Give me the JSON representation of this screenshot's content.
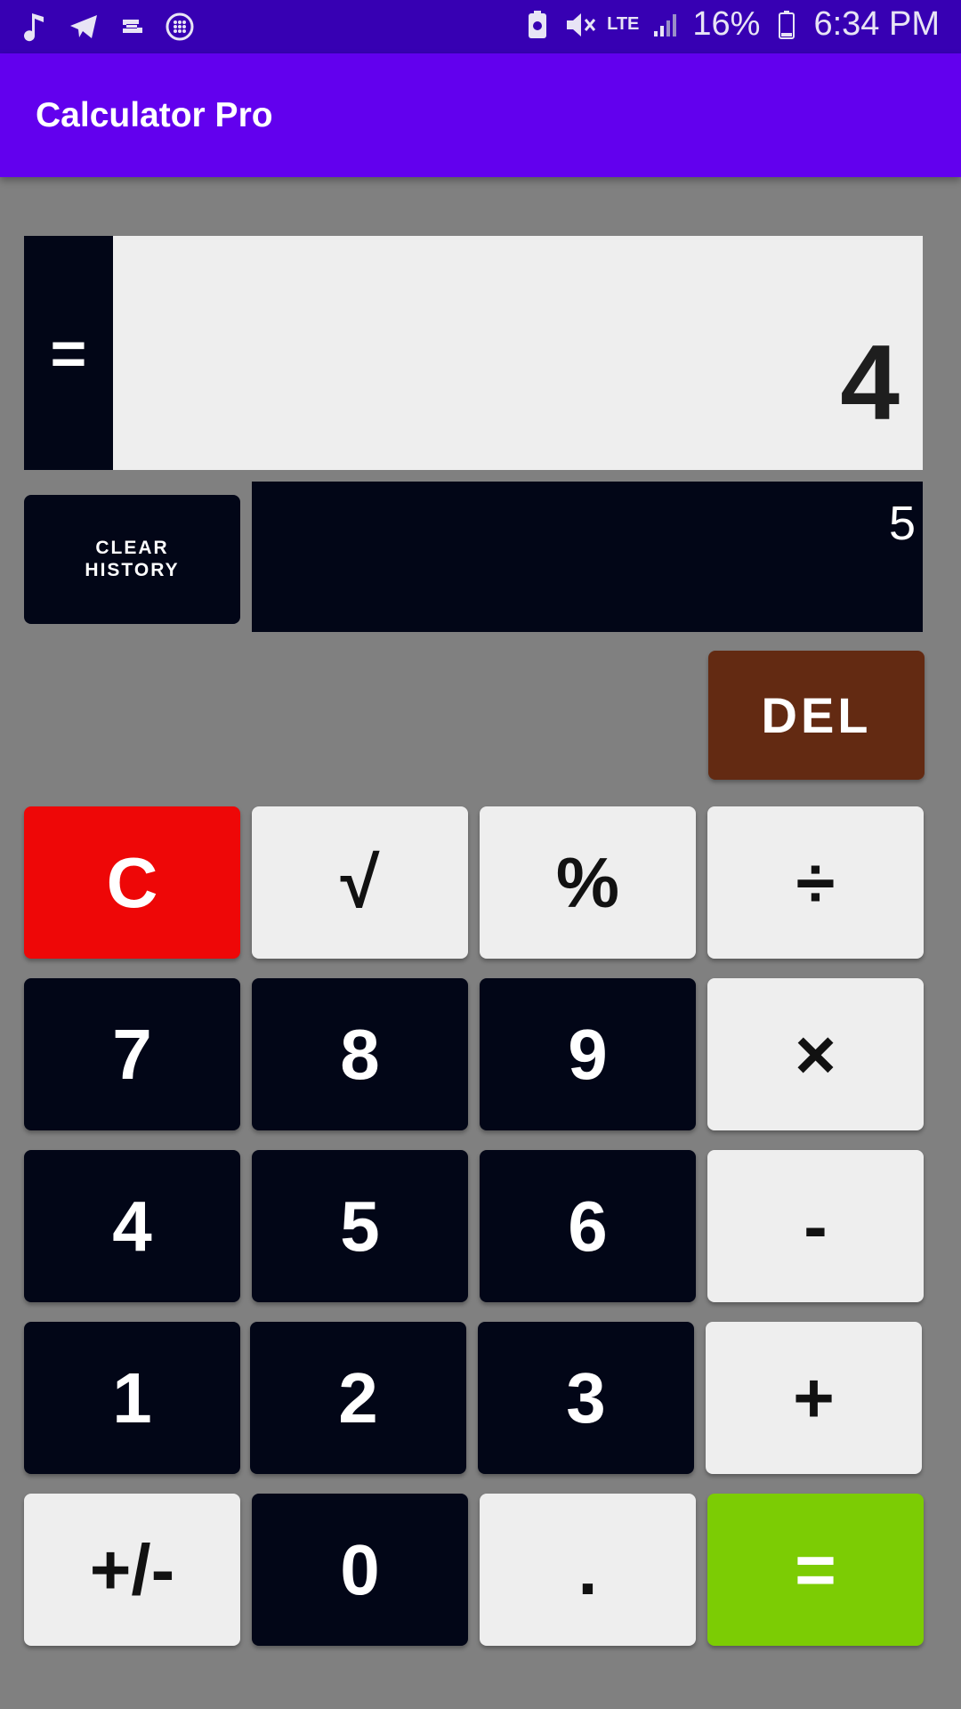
{
  "status_bar": {
    "left_icons": [
      "music-note-icon",
      "telegram-icon",
      "cast-icon",
      "circle-dots-icon"
    ],
    "network": "LTE",
    "battery": "16%",
    "time": "6:34 PM"
  },
  "app_bar": {
    "title": "Calculator Pro"
  },
  "display": {
    "equals_label": "=",
    "result": "4",
    "history_value": "5"
  },
  "buttons": {
    "clear_history": "CLEAR\nHISTORY",
    "del": "DEL",
    "keys": [
      {
        "label": "C",
        "style": "red"
      },
      {
        "label": "√",
        "style": "light"
      },
      {
        "label": "%",
        "style": "light"
      },
      {
        "label": "÷",
        "style": "light"
      },
      {
        "label": "7",
        "style": "dark"
      },
      {
        "label": "8",
        "style": "dark"
      },
      {
        "label": "9",
        "style": "dark"
      },
      {
        "label": "×",
        "style": "light"
      },
      {
        "label": "4",
        "style": "dark"
      },
      {
        "label": "5",
        "style": "dark"
      },
      {
        "label": "6",
        "style": "dark"
      },
      {
        "label": "-",
        "style": "light"
      },
      {
        "label": "1",
        "style": "dark"
      },
      {
        "label": "2",
        "style": "dark"
      },
      {
        "label": "3",
        "style": "dark"
      },
      {
        "label": "+",
        "style": "light"
      },
      {
        "label": "+/-",
        "style": "light"
      },
      {
        "label": "0",
        "style": "dark"
      },
      {
        "label": ".",
        "style": "light"
      },
      {
        "label": "=",
        "style": "green"
      }
    ]
  },
  "colors": {
    "status_bar": "#3700b3",
    "app_bar": "#6200ee",
    "background": "#808080",
    "dark_key": "#020617",
    "light_key": "#eeeeee",
    "clear_key": "#ee0707",
    "equals_key": "#7ccc04",
    "del_key": "#632a12"
  }
}
